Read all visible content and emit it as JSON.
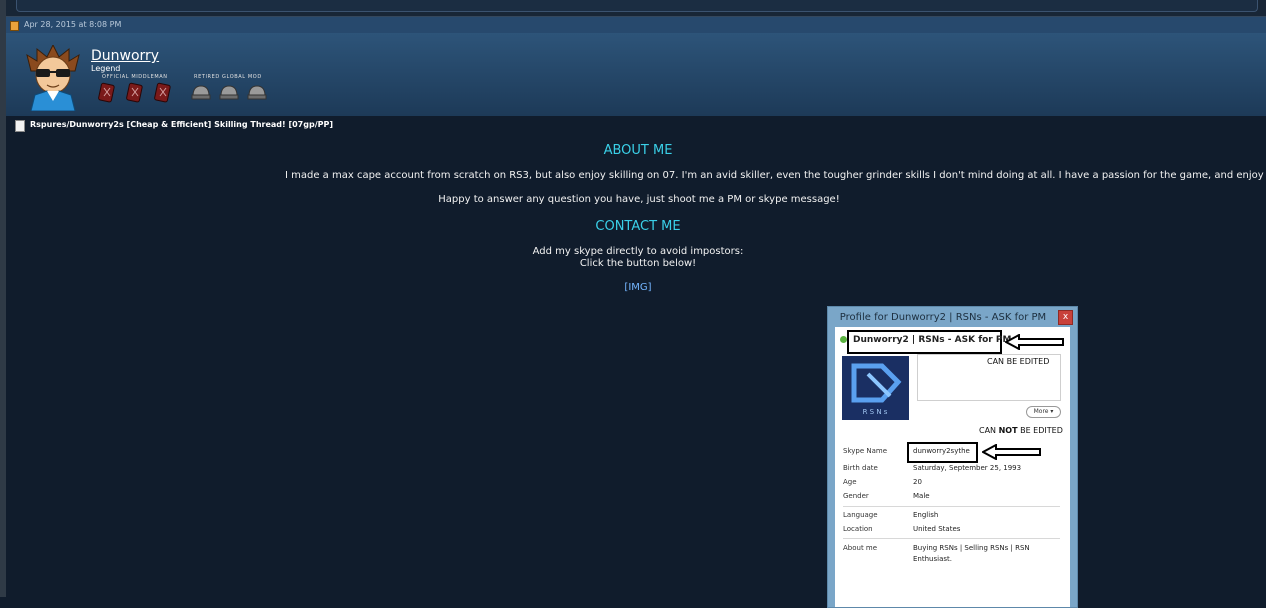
{
  "post": {
    "date": "Apr 28, 2015 at 8:08 PM",
    "username": "Dunworry",
    "user_title": "Legend",
    "ranks": [
      {
        "label": "OFFICIAL MIDDLEMAN",
        "icon": "middleman-badge-icon",
        "count": 3
      },
      {
        "label": "RETIRED GLOBAL MOD",
        "icon": "helmet-badge-icon",
        "count": 3
      }
    ],
    "thread_title": "Rspures/Dunworry2s [Cheap & Efficient] Skilling Thread! [07gp/PP]"
  },
  "content": {
    "about_heading": "ABOUT ME",
    "about_text": "I made a max cape account from scratch on RS3, but also enjoy skilling on 07. I'm an avid skiller, even the tougher grinder skills I don't mind doing at all. I have a passion for the game, and enjoy p",
    "happy_text": "Happy to answer any question you have, just shoot me a PM or skype message!",
    "contact_heading": "CONTACT ME",
    "skype_line1": "Add my skype directly to avoid impostors:",
    "skype_line2": "Click the button below!",
    "img_link": "[IMG]"
  },
  "skype_profile": {
    "window_title": "Profile for Dunworry2 | RSNs  - ASK for PM",
    "display_name": "Dunworry2 | RSNs  - ASK for PM",
    "editable_note": "CAN BE EDITED",
    "more_button": "More ▾",
    "not_editable_prefix": "CAN ",
    "not_editable_bold": "NOT",
    "not_editable_suffix": " BE EDITED",
    "avatar_caption": "R S N s",
    "fields": {
      "skype_name_label": "Skype Name",
      "skype_name": "dunworry2sythe",
      "birth_label": "Birth date",
      "birth": "Saturday, September 25, 1993",
      "age_label": "Age",
      "age": "20",
      "gender_label": "Gender",
      "gender": "Male",
      "language_label": "Language",
      "language": "English",
      "location_label": "Location",
      "location": "United States",
      "about_label": "About me",
      "about_line1": "Buying RSNs | Selling RSNs | RSN",
      "about_line2": "Enthusiast."
    }
  },
  "colors": {
    "background": "#101c2c",
    "heading": "#3ad0e8",
    "link": "#74b6ff",
    "user_bar": "#2d5479"
  }
}
